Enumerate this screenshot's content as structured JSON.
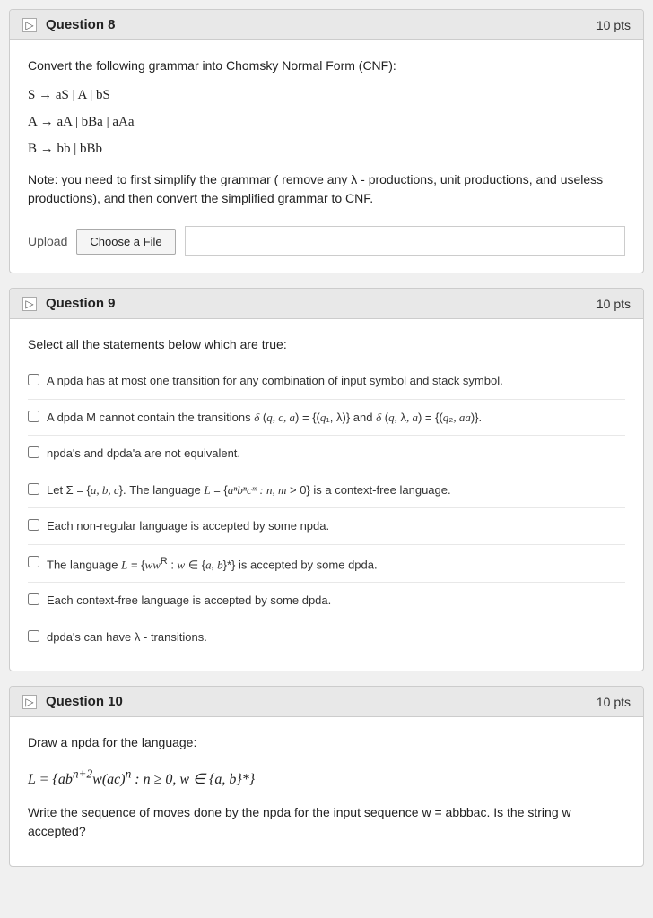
{
  "questions": [
    {
      "id": "q8",
      "number": "Question 8",
      "pts": "10 pts",
      "body_intro": "Convert the following grammar into Chomsky Normal Form (CNF):",
      "grammar_lines": [
        "S → aS | A | bS",
        "A → aA | bBa | aAa",
        "B → bb | bBb"
      ],
      "note": "Note: you need to first simplify the grammar ( remove any λ - productions, unit productions, and useless productions), and then convert the simplified grammar to CNF.",
      "upload_label": "Upload",
      "choose_file_label": "Choose a File"
    },
    {
      "id": "q9",
      "number": "Question 9",
      "pts": "10 pts",
      "intro": "Select all the statements below which are true:",
      "options": [
        "A npda has at most one transition for any combination of input symbol and stack symbol.",
        "A dpda M cannot contain the transitions δ(q, c, a) = {(q₁, λ)} and δ(q, λ, a) = {(q₂, aa)}.",
        "npda's and dpda'a are not equivalent.",
        "Let Σ = {a, b, c}. The language L = {aⁿbⁿcᵐ : n, m > 0} is a context-free language.",
        "Each non-regular language is accepted by some npda.",
        "The language L = {wwᴿ : w ∈ {a, b}*} is accepted by some dpda.",
        "Each context-free language is accepted by some dpda.",
        "dpda's can have λ - transitions."
      ]
    },
    {
      "id": "q10",
      "number": "Question 10",
      "pts": "10 pts",
      "intro": "Draw a npda for the language:",
      "language": "L = {ab^(n+2)w(ac)^n : n ≥ 0, w ∈ {a, b}*}",
      "followup": "Write the sequence of moves done by the npda for the input sequence w = abbbac. Is the string w accepted?"
    }
  ]
}
